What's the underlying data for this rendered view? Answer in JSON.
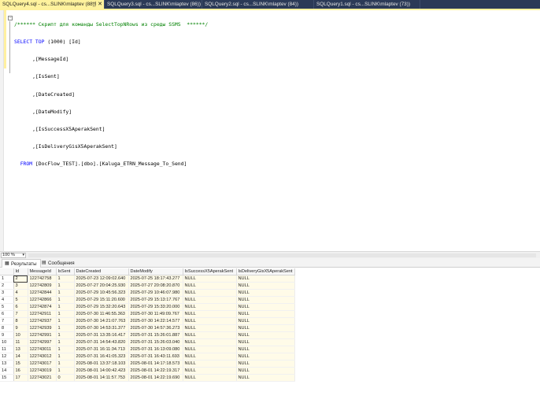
{
  "tabs": [
    {
      "label": "SQLQuery4.sql - cs...SLINK\\mlaptev (88))",
      "pin": "⊣",
      "close": "✕",
      "active": true
    },
    {
      "label": "SQLQuery3.sql - cs...SLINK\\mlaptev (86))",
      "active": false
    },
    {
      "label": "SQLQuery2.sql - cs...SLINK\\mlaptev (84))",
      "active": false
    },
    {
      "label": "SQLQuery1.sql - cs...SLINK\\mlaptev (73))",
      "active": false
    }
  ],
  "editor": {
    "comment": "/****** Скрипт для команды SelectTopNRows из среды SSMS  ******/",
    "lines": [
      {
        "indent": "",
        "kw": "SELECT TOP ",
        "rest": "(1000) [Id]"
      },
      {
        "indent": "      ",
        "kw": "",
        "rest": ",[MessageId]"
      },
      {
        "indent": "      ",
        "kw": "",
        "rest": ",[IsSent]"
      },
      {
        "indent": "      ",
        "kw": "",
        "rest": ",[DateCreated]"
      },
      {
        "indent": "      ",
        "kw": "",
        "rest": ",[DateModify]"
      },
      {
        "indent": "      ",
        "kw": "",
        "rest": ",[IsSuccessX5AperakSent]"
      },
      {
        "indent": "      ",
        "kw": "",
        "rest": ",[IsDeliveryGisX5AperakSent]"
      },
      {
        "indent": "  ",
        "kw": "FROM ",
        "rest": "[DocFlow_TEST].[dbo].[Kaluga_ETRN_Message_To_Send]"
      }
    ]
  },
  "zoom": {
    "value": "100 %"
  },
  "result_tabs": [
    {
      "label": "Результаты",
      "icon": "grid-icon",
      "active": true
    },
    {
      "label": "Сообщения",
      "icon": "messages-icon",
      "active": false
    }
  ],
  "grid": {
    "columns": [
      "Id",
      "MessageId",
      "IsSent",
      "DateCreated",
      "DateModify",
      "IsSuccessX5AperakSent",
      "IsDeliveryGisX5AperakSent"
    ],
    "rows": [
      [
        "1",
        "2",
        "122742758",
        "1",
        "2025-07-23 12:09:02.640",
        "2025-07-25 18:17:43.277",
        "NULL",
        "NULL"
      ],
      [
        "2",
        "3",
        "122742809",
        "1",
        "2025-07-27 20:04:25.930",
        "2025-07-27 20:08:20.870",
        "NULL",
        "NULL"
      ],
      [
        "3",
        "4",
        "122742844",
        "1",
        "2025-07-29 10:45:56.323",
        "2025-07-29 10:46:07.980",
        "NULL",
        "NULL"
      ],
      [
        "4",
        "5",
        "122742866",
        "1",
        "2025-07-29 15:11:20.600",
        "2025-07-29 15:13:17.767",
        "NULL",
        "NULL"
      ],
      [
        "5",
        "6",
        "122742874",
        "1",
        "2025-07-29 15:32:20.643",
        "2025-07-29 15:33:20.000",
        "NULL",
        "NULL"
      ],
      [
        "6",
        "7",
        "122742911",
        "1",
        "2025-07-30 11:46:55.363",
        "2025-07-30 11:49:09.767",
        "NULL",
        "NULL"
      ],
      [
        "7",
        "8",
        "122742937",
        "1",
        "2025-07-30 14:21:07.763",
        "2025-07-30 14:22:14.577",
        "NULL",
        "NULL"
      ],
      [
        "8",
        "9",
        "122742939",
        "1",
        "2025-07-30 14:53:31.377",
        "2025-07-30 14:57:36.273",
        "NULL",
        "NULL"
      ],
      [
        "9",
        "10",
        "122742991",
        "1",
        "2025-07-31 13:35:16.417",
        "2025-07-31 15:26:01.887",
        "NULL",
        "NULL"
      ],
      [
        "10",
        "11",
        "122742997",
        "1",
        "2025-07-31 14:54:43.820",
        "2025-07-31 15:26:03.040",
        "NULL",
        "NULL"
      ],
      [
        "11",
        "13",
        "122743011",
        "1",
        "2025-07-31 16:11:34.713",
        "2025-07-31 16:13:09.080",
        "NULL",
        "NULL"
      ],
      [
        "12",
        "14",
        "122743012",
        "1",
        "2025-07-31 16:41:05.323",
        "2025-07-31 16:43:11.693",
        "NULL",
        "NULL"
      ],
      [
        "13",
        "15",
        "122743017",
        "1",
        "2025-08-01 13:37:18.103",
        "2025-08-01 14:17:18.573",
        "NULL",
        "NULL"
      ],
      [
        "14",
        "16",
        "122743019",
        "1",
        "2025-08-01 14:00:42.423",
        "2025-08-01 14:22:19.317",
        "NULL",
        "NULL"
      ],
      [
        "15",
        "17",
        "122743021",
        "0",
        "2025-08-01 14:11:57.753",
        "2025-08-01 14:22:19.690",
        "NULL",
        "NULL"
      ]
    ]
  },
  "colors": {
    "active_tab": "#fff29d",
    "tab_bar": "#2b3a57",
    "keyword": "#0000ff",
    "comment": "#008000",
    "result_cell": "#fffbe8"
  }
}
